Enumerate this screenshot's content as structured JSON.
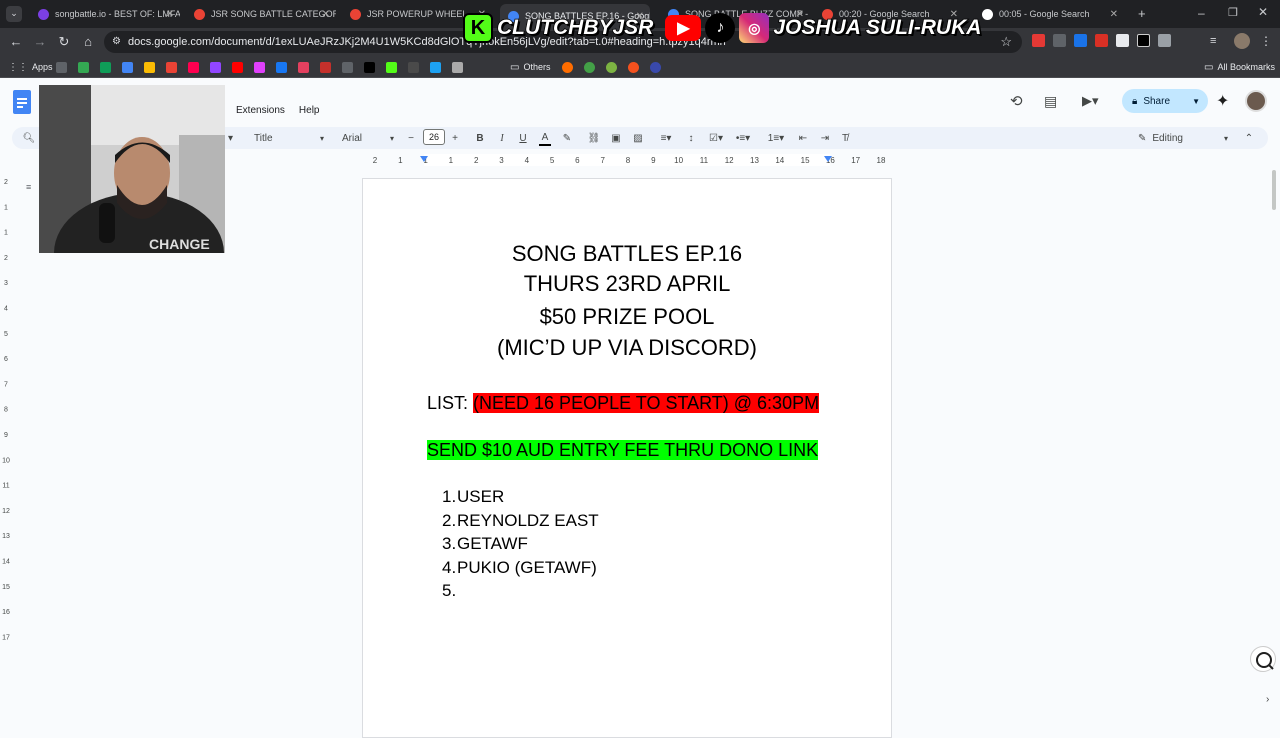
{
  "browser": {
    "tabs": [
      {
        "title": "songbattle.io - BEST OF: LMFAO",
        "color": "#7b3fe4"
      },
      {
        "title": "JSR SONG BATTLE CATEGORY",
        "color": "#ea4335"
      },
      {
        "title": "JSR POWERUP WHEEL",
        "color": "#ea4335"
      },
      {
        "title": "SONG BATTLES EP.16 - Google",
        "color": "#4285f4",
        "active": true
      },
      {
        "title": "SONG BATTLE BUZZ COMP - Google",
        "color": "#4285f4"
      },
      {
        "title": "00:20 - Google Search",
        "color": "#ea4335"
      },
      {
        "title": "00:05 - Google Search",
        "color": "#ffffff"
      }
    ],
    "url": "docs.google.com/document/d/1exLUAeJRzJKj2M4U1W5KCd8dGlOTqYjriokEn56jLVg/edit?tab=t.0#heading=h.tpzy1q4rmn",
    "bookmarks": {
      "apps": "Apps",
      "others": "Others",
      "all": "All Bookmarks"
    }
  },
  "docs": {
    "menu": {
      "extensions": "Extensions",
      "help": "Help"
    },
    "share_label": "Share",
    "toolbar": {
      "style": "Title",
      "font": "Arial",
      "font_size": "26",
      "mode": "Editing"
    }
  },
  "document": {
    "title_lines": [
      "SONG BATTLES EP.16",
      "THURS 23RD APRIL",
      "$50 PRIZE POOL",
      "(MIC’D UP VIA DISCORD)"
    ],
    "list_label": "LIST: ",
    "list_highlight": "(NEED 16 PEOPLE TO START) @ 6:30PM",
    "entry_fee": "SEND $10 AUD ENTRY FEE THRU DONO LINK",
    "entries": [
      {
        "num": "1.",
        "name": "USER"
      },
      {
        "num": "2.",
        "name": "REYNOLDZ EAST"
      },
      {
        "num": "3.",
        "name": "GETAWF"
      },
      {
        "num": "4.",
        "name": "PUKIO (GETAWF)"
      },
      {
        "num": "5.",
        "name": ""
      }
    ]
  },
  "overlay": {
    "kick_handle": "CLUTCHBYJSR",
    "social_handle": "JOSHUA SULI-RUKA",
    "webcam_shirt_text": "CHANGE"
  },
  "ruler": {
    "ticks": [
      "2",
      "1",
      "1",
      "1",
      "2",
      "3",
      "4",
      "5",
      "6",
      "7",
      "8",
      "9",
      "10",
      "11",
      "12",
      "13",
      "14",
      "15",
      "16",
      "17",
      "18"
    ],
    "vticks": [
      "2",
      "1",
      "1",
      "2",
      "3",
      "4",
      "5",
      "6",
      "7",
      "8",
      "9",
      "10",
      "11",
      "12",
      "13",
      "14",
      "15",
      "16",
      "17"
    ]
  },
  "colors": {
    "highlight_red": "#ff0000",
    "highlight_green": "#00ff00",
    "share_bg": "#c2e7ff",
    "kick_green": "#53fc18",
    "youtube_red": "#ff0000"
  }
}
